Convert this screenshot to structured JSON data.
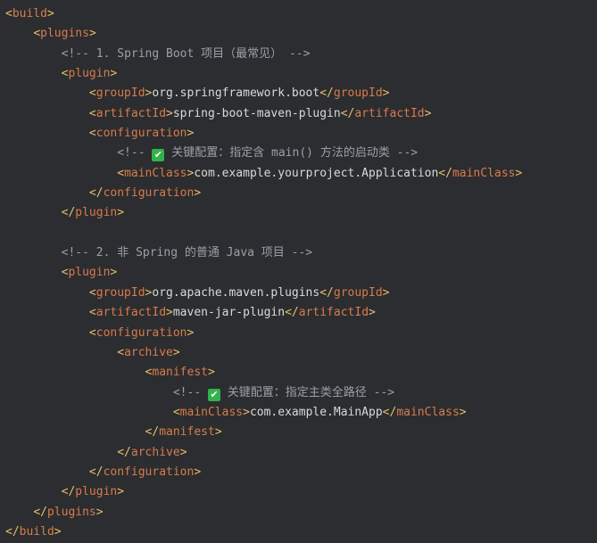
{
  "lines": [
    {
      "indent": "",
      "parts": [
        {
          "c": "tagname-orange",
          "t": "<"
        },
        {
          "c": "tag-orange",
          "t": "build"
        },
        {
          "c": "tagname-orange",
          "t": ">"
        }
      ]
    },
    {
      "indent": "    ",
      "parts": [
        {
          "c": "tagname-orange",
          "t": "<"
        },
        {
          "c": "tag-orange",
          "t": "plugins"
        },
        {
          "c": "tagname-orange",
          "t": ">"
        }
      ]
    },
    {
      "indent": "        ",
      "parts": [
        {
          "c": "comment",
          "t": "<!-- 1. Spring Boot 项目（最常见） -->"
        }
      ]
    },
    {
      "indent": "        ",
      "parts": [
        {
          "c": "tagname-orange",
          "t": "<"
        },
        {
          "c": "tag-orange",
          "t": "plugin"
        },
        {
          "c": "tagname-orange",
          "t": ">"
        }
      ]
    },
    {
      "indent": "            ",
      "parts": [
        {
          "c": "tagname-orange",
          "t": "<"
        },
        {
          "c": "tag-orange",
          "t": "groupId"
        },
        {
          "c": "tagname-orange",
          "t": ">"
        },
        {
          "c": "text",
          "t": "org.springframework.boot"
        },
        {
          "c": "tagname-orange",
          "t": "</"
        },
        {
          "c": "tag-orange",
          "t": "groupId"
        },
        {
          "c": "tagname-orange",
          "t": ">"
        }
      ]
    },
    {
      "indent": "            ",
      "parts": [
        {
          "c": "tagname-orange",
          "t": "<"
        },
        {
          "c": "tag-orange",
          "t": "artifactId"
        },
        {
          "c": "tagname-orange",
          "t": ">"
        },
        {
          "c": "text",
          "t": "spring-boot-maven-plugin"
        },
        {
          "c": "tagname-orange",
          "t": "</"
        },
        {
          "c": "tag-orange",
          "t": "artifactId"
        },
        {
          "c": "tagname-orange",
          "t": ">"
        }
      ]
    },
    {
      "indent": "            ",
      "parts": [
        {
          "c": "tagname-orange",
          "t": "<"
        },
        {
          "c": "tag-orange",
          "t": "configuration"
        },
        {
          "c": "tagname-orange",
          "t": ">"
        }
      ]
    },
    {
      "indent": "                ",
      "parts": [
        {
          "c": "comment",
          "t": "<!-- "
        },
        {
          "c": "check",
          "t": "✔"
        },
        {
          "c": "comment",
          "t": " 关键配置：指定含 main() 方法的启动类 -->"
        }
      ]
    },
    {
      "indent": "                ",
      "parts": [
        {
          "c": "tagname-orange",
          "t": "<"
        },
        {
          "c": "tag-orange",
          "t": "mainClass"
        },
        {
          "c": "tagname-orange",
          "t": ">"
        },
        {
          "c": "text",
          "t": "com.example.yourproject.Application"
        },
        {
          "c": "tagname-orange",
          "t": "</"
        },
        {
          "c": "tag-orange",
          "t": "mainClass"
        },
        {
          "c": "tagname-orange",
          "t": ">"
        }
      ]
    },
    {
      "indent": "            ",
      "parts": [
        {
          "c": "tagname-orange",
          "t": "</"
        },
        {
          "c": "tag-orange",
          "t": "configuration"
        },
        {
          "c": "tagname-orange",
          "t": ">"
        }
      ]
    },
    {
      "indent": "        ",
      "parts": [
        {
          "c": "tagname-orange",
          "t": "</"
        },
        {
          "c": "tag-orange",
          "t": "plugin"
        },
        {
          "c": "tagname-orange",
          "t": ">"
        }
      ]
    },
    {
      "indent": "",
      "parts": []
    },
    {
      "indent": "        ",
      "parts": [
        {
          "c": "comment",
          "t": "<!-- 2. 非 Spring 的普通 Java 项目 -->"
        }
      ]
    },
    {
      "indent": "        ",
      "parts": [
        {
          "c": "tagname-orange",
          "t": "<"
        },
        {
          "c": "tag-orange",
          "t": "plugin"
        },
        {
          "c": "tagname-orange",
          "t": ">"
        }
      ]
    },
    {
      "indent": "            ",
      "parts": [
        {
          "c": "tagname-orange",
          "t": "<"
        },
        {
          "c": "tag-orange",
          "t": "groupId"
        },
        {
          "c": "tagname-orange",
          "t": ">"
        },
        {
          "c": "text",
          "t": "org.apache.maven.plugins"
        },
        {
          "c": "tagname-orange",
          "t": "</"
        },
        {
          "c": "tag-orange",
          "t": "groupId"
        },
        {
          "c": "tagname-orange",
          "t": ">"
        }
      ]
    },
    {
      "indent": "            ",
      "parts": [
        {
          "c": "tagname-orange",
          "t": "<"
        },
        {
          "c": "tag-orange",
          "t": "artifactId"
        },
        {
          "c": "tagname-orange",
          "t": ">"
        },
        {
          "c": "text",
          "t": "maven-jar-plugin"
        },
        {
          "c": "tagname-orange",
          "t": "</"
        },
        {
          "c": "tag-orange",
          "t": "artifactId"
        },
        {
          "c": "tagname-orange",
          "t": ">"
        }
      ]
    },
    {
      "indent": "            ",
      "parts": [
        {
          "c": "tagname-orange",
          "t": "<"
        },
        {
          "c": "tag-orange",
          "t": "configuration"
        },
        {
          "c": "tagname-orange",
          "t": ">"
        }
      ]
    },
    {
      "indent": "                ",
      "parts": [
        {
          "c": "tagname-orange",
          "t": "<"
        },
        {
          "c": "tag-orange",
          "t": "archive"
        },
        {
          "c": "tagname-orange",
          "t": ">"
        }
      ]
    },
    {
      "indent": "                    ",
      "parts": [
        {
          "c": "tagname-orange",
          "t": "<"
        },
        {
          "c": "tag-orange",
          "t": "manifest"
        },
        {
          "c": "tagname-orange",
          "t": ">"
        }
      ]
    },
    {
      "indent": "                        ",
      "parts": [
        {
          "c": "comment",
          "t": "<!-- "
        },
        {
          "c": "check",
          "t": "✔"
        },
        {
          "c": "comment",
          "t": " 关键配置：指定主类全路径 -->"
        }
      ]
    },
    {
      "indent": "                        ",
      "parts": [
        {
          "c": "tagname-orange",
          "t": "<"
        },
        {
          "c": "tag-orange",
          "t": "mainClass"
        },
        {
          "c": "tagname-orange",
          "t": ">"
        },
        {
          "c": "text",
          "t": "com.example.MainApp"
        },
        {
          "c": "tagname-orange",
          "t": "</"
        },
        {
          "c": "tag-orange",
          "t": "mainClass"
        },
        {
          "c": "tagname-orange",
          "t": ">"
        }
      ]
    },
    {
      "indent": "                    ",
      "parts": [
        {
          "c": "tagname-orange",
          "t": "</"
        },
        {
          "c": "tag-orange",
          "t": "manifest"
        },
        {
          "c": "tagname-orange",
          "t": ">"
        }
      ]
    },
    {
      "indent": "                ",
      "parts": [
        {
          "c": "tagname-orange",
          "t": "</"
        },
        {
          "c": "tag-orange",
          "t": "archive"
        },
        {
          "c": "tagname-orange",
          "t": ">"
        }
      ]
    },
    {
      "indent": "            ",
      "parts": [
        {
          "c": "tagname-orange",
          "t": "</"
        },
        {
          "c": "tag-orange",
          "t": "configuration"
        },
        {
          "c": "tagname-orange",
          "t": ">"
        }
      ]
    },
    {
      "indent": "        ",
      "parts": [
        {
          "c": "tagname-orange",
          "t": "</"
        },
        {
          "c": "tag-orange",
          "t": "plugin"
        },
        {
          "c": "tagname-orange",
          "t": ">"
        }
      ]
    },
    {
      "indent": "    ",
      "parts": [
        {
          "c": "tagname-orange",
          "t": "</"
        },
        {
          "c": "tag-orange",
          "t": "plugins"
        },
        {
          "c": "tagname-orange",
          "t": ">"
        }
      ]
    },
    {
      "indent": "",
      "parts": [
        {
          "c": "tagname-orange",
          "t": "</"
        },
        {
          "c": "tag-orange",
          "t": "build"
        },
        {
          "c": "tagname-orange",
          "t": ">"
        }
      ]
    }
  ],
  "colors": {
    "background": "#2b2d30",
    "tag": "#d97b4a",
    "bracket": "#e8bf6a",
    "comment": "#9aa0a6",
    "text": "#d9d9d9",
    "check": "#31b24b"
  }
}
